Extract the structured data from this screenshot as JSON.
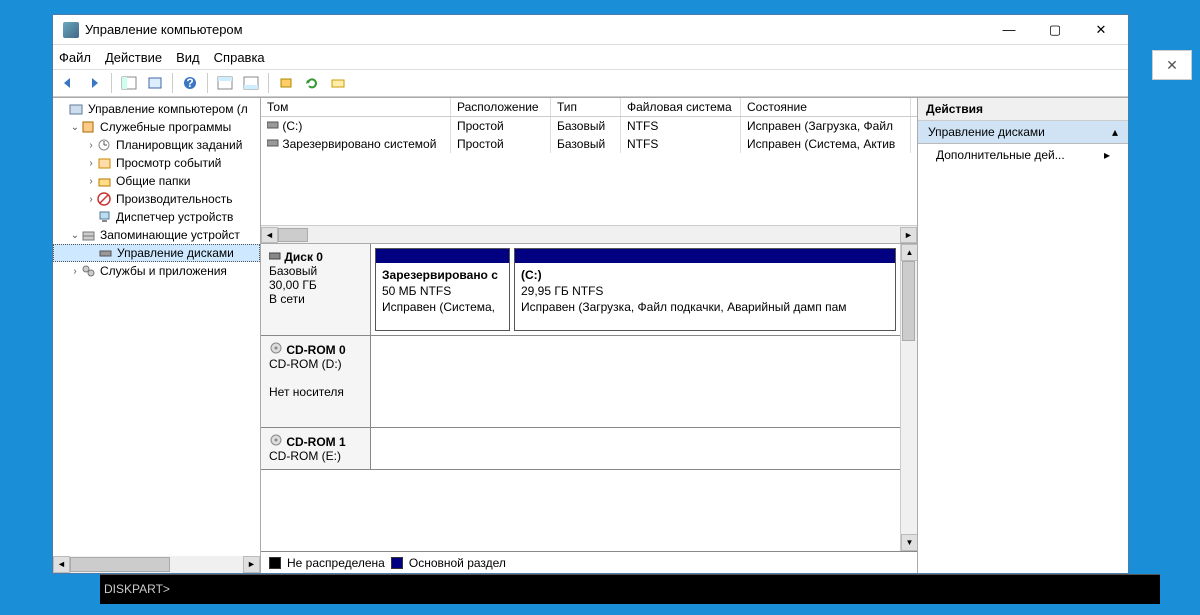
{
  "window": {
    "title": "Управление компьютером"
  },
  "menu": {
    "file": "Файл",
    "action": "Действие",
    "view": "Вид",
    "help": "Справка"
  },
  "tree": {
    "root": "Управление компьютером (л",
    "sys_tools": "Служебные программы",
    "task_scheduler": "Планировщик заданий",
    "event_viewer": "Просмотр событий",
    "shared_folders": "Общие папки",
    "performance": "Производительность",
    "device_manager": "Диспетчер устройств",
    "storage": "Запоминающие устройст",
    "disk_mgmt": "Управление дисками",
    "services": "Службы и приложения"
  },
  "volumes": {
    "headers": {
      "volume": "Том",
      "layout": "Расположение",
      "type": "Тип",
      "fs": "Файловая система",
      "status": "Состояние"
    },
    "rows": [
      {
        "name": "(C:)",
        "layout": "Простой",
        "type": "Базовый",
        "fs": "NTFS",
        "status": "Исправен (Загрузка, Файл"
      },
      {
        "name": "Зарезервировано системой",
        "layout": "Простой",
        "type": "Базовый",
        "fs": "NTFS",
        "status": "Исправен (Система, Актив"
      }
    ]
  },
  "disks": {
    "d0": {
      "name": "Диск 0",
      "type": "Базовый",
      "size": "30,00 ГБ",
      "status": "В сети",
      "p1": {
        "name": "Зарезервировано с",
        "size": "50 МБ NTFS",
        "status": "Исправен (Система,"
      },
      "p2": {
        "name": "(C:)",
        "size": "29,95 ГБ NTFS",
        "status": "Исправен (Загрузка, Файл подкачки, Аварийный дамп пам"
      }
    },
    "cd0": {
      "name": "CD-ROM 0",
      "drive": "CD-ROM (D:)",
      "status": "Нет носителя"
    },
    "cd1": {
      "name": "CD-ROM 1",
      "drive": "CD-ROM (E:)"
    }
  },
  "legend": {
    "unalloc": "Не распределена",
    "primary": "Основной раздел"
  },
  "actions": {
    "header": "Действия",
    "selected": "Управление дисками",
    "more": "Дополнительные дей..."
  },
  "cmd": {
    "prompt": "DISKPART>"
  }
}
